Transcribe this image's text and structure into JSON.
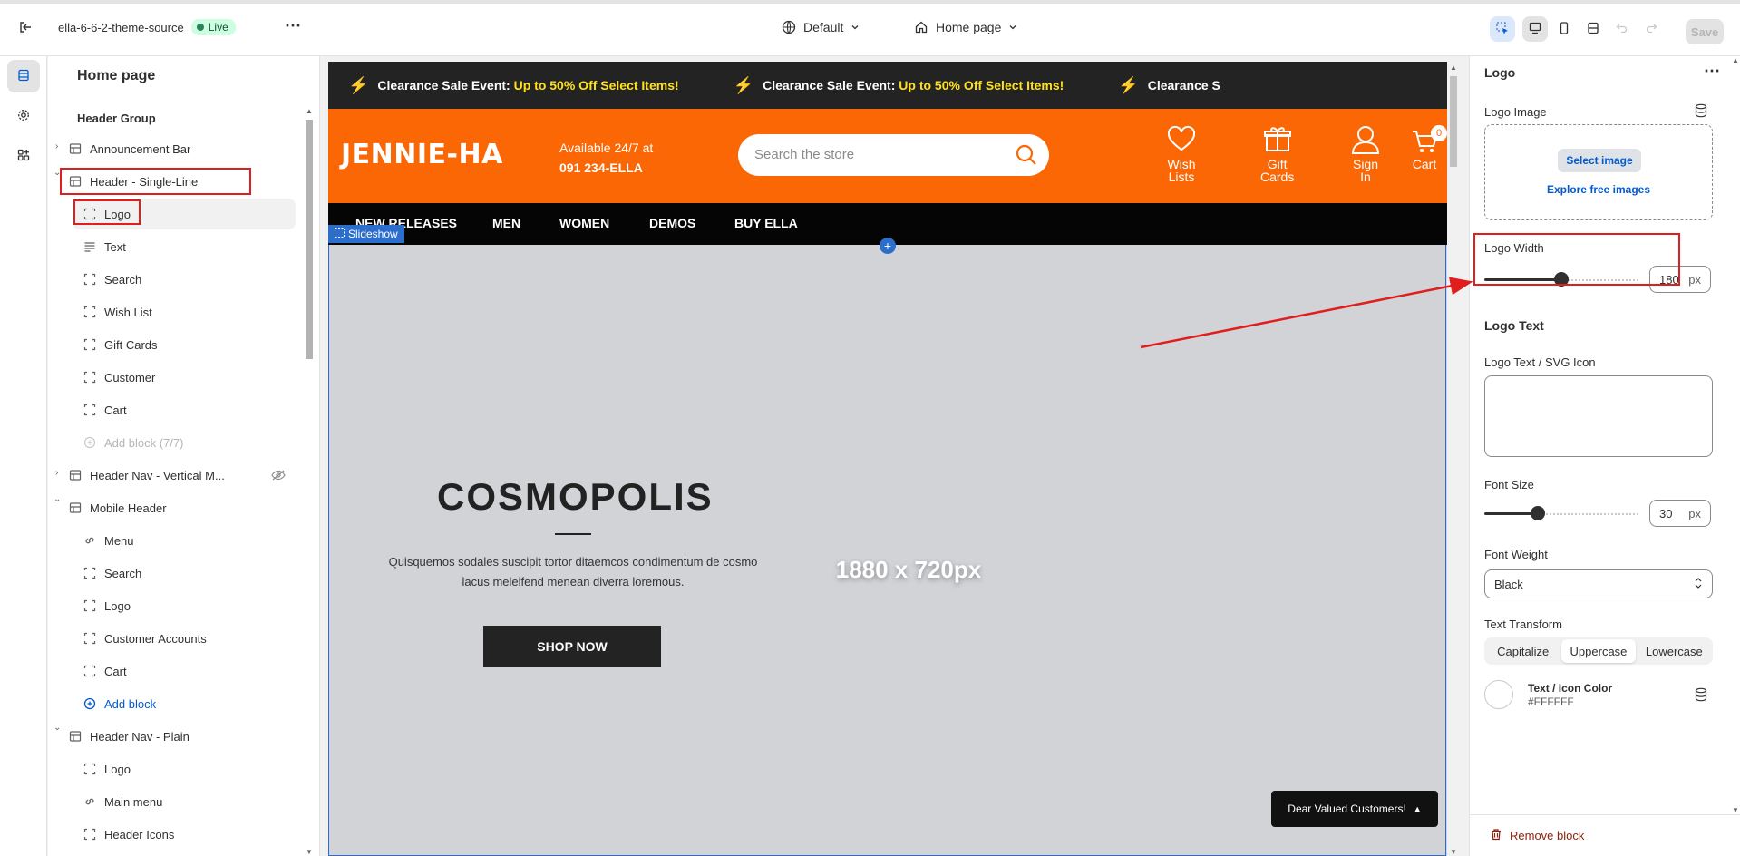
{
  "topbar": {
    "store_name": "ella-6-6-2-theme-source",
    "live_label": "Live",
    "theme_select": "Default",
    "page_select": "Home page",
    "save_label": "Save"
  },
  "left_panel": {
    "title": "Home page",
    "group_title": "Header Group",
    "sections": [
      {
        "label": "Announcement Bar"
      },
      {
        "label": "Header - Single-Line"
      },
      {
        "label": "Header Nav - Vertical M..."
      },
      {
        "label": "Mobile Header"
      },
      {
        "label": "Header Nav - Plain"
      }
    ],
    "header_blocks": [
      "Logo",
      "Text",
      "Search",
      "Wish List",
      "Gift Cards",
      "Customer",
      "Cart"
    ],
    "add_block_disabled": "Add block (7/7)",
    "mobile_blocks": [
      "Menu",
      "Search",
      "Logo",
      "Customer Accounts",
      "Cart"
    ],
    "add_block": "Add block",
    "plain_blocks": [
      "Logo",
      "Main menu",
      "Header Icons"
    ]
  },
  "preview": {
    "announcement": [
      {
        "prefix": "Clearance Sale Event:",
        "highlight": "Up to 50% Off Select Items!"
      },
      {
        "prefix": "Clearance Sale Event:",
        "highlight": "Up to 50% Off Select Items!"
      },
      {
        "prefix": "Clearance S",
        "highlight": ""
      }
    ],
    "logo": "JENNIE-HA",
    "available": "Available 24/7 at",
    "phone": "091 234-ELLA",
    "search_placeholder": "Search the store",
    "icons": [
      {
        "name": "heart-icon",
        "line1": "Wish",
        "line2": "Lists"
      },
      {
        "name": "gift-icon",
        "line1": "Gift",
        "line2": "Cards"
      },
      {
        "name": "user-icon",
        "line1": "Sign",
        "line2": "In"
      },
      {
        "name": "cart-icon",
        "line1": "Cart",
        "line2": ""
      }
    ],
    "cart_count": "0",
    "nav": [
      "NEW RELEASES",
      "MEN",
      "WOMEN",
      "DEMOS",
      "BUY ELLA"
    ],
    "slideshow_tag": "Slideshow",
    "slide_title": "COSMOPOLIS",
    "slide_desc": "Quisquemos sodales suscipit tortor ditaemcos condimentum de cosmo lacus meleifend menean diverra loremous.",
    "slide_button": "SHOP NOW",
    "image_dims": "1880 x 720px",
    "dear_button": "Dear Valued Customers!",
    "colors": {
      "announcement_bg": "#232323",
      "header_bg": "#fb6705",
      "highlight": "#ffe21b"
    }
  },
  "right_panel": {
    "title": "Logo",
    "logo_image_label": "Logo Image",
    "select_image": "Select image",
    "explore_images": "Explore free images",
    "logo_width_label": "Logo Width",
    "logo_width_value": "180",
    "logo_width_unit": "px",
    "logo_width_fraction": 0.5,
    "logo_text_heading": "Logo Text",
    "logo_text_label": "Logo Text / SVG Icon",
    "font_size_label": "Font Size",
    "font_size_value": "30",
    "font_size_unit": "px",
    "font_size_fraction": 0.35,
    "font_weight_label": "Font Weight",
    "font_weight_value": "Black",
    "text_transform_label": "Text Transform",
    "text_transform_options": [
      "Capitalize",
      "Uppercase",
      "Lowercase"
    ],
    "text_transform_selected": "Uppercase",
    "color_label": "Text / Icon Color",
    "color_value": "#FFFFFF",
    "remove_block": "Remove block"
  }
}
